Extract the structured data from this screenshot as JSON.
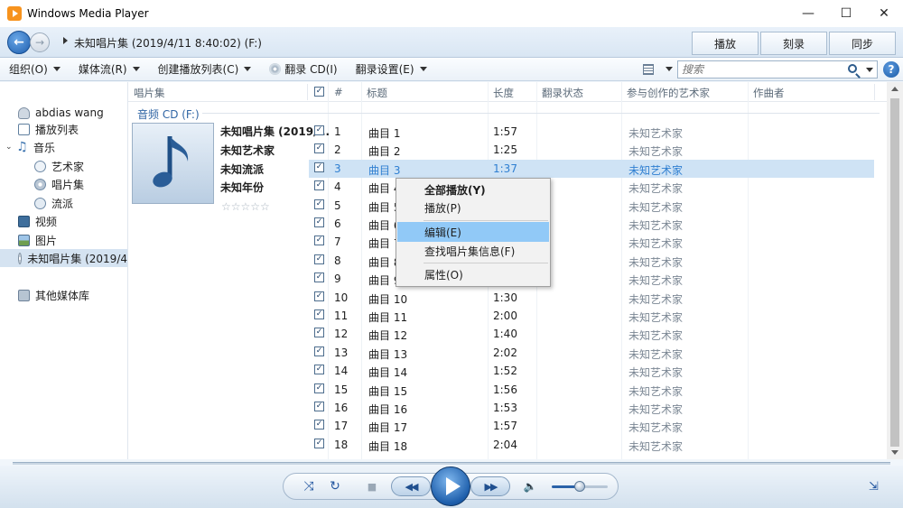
{
  "window": {
    "title": "Windows Media Player",
    "minimize": "—",
    "maximize": "☐",
    "close": "✕"
  },
  "nav": {
    "back": "←",
    "forward": "→",
    "breadcrumb": "未知唱片集 (2019/4/11 8:40:02) (F:)",
    "tabs": [
      "播放",
      "刻录",
      "同步"
    ]
  },
  "toolbar": {
    "organize": "组织(O)",
    "stream": "媒体流(R)",
    "create_playlist": "创建播放列表(C)",
    "rip_cd": "翻录 CD(I)",
    "rip_settings": "翻录设置(E)",
    "search_placeholder": "搜索",
    "help": "?"
  },
  "sidebar": {
    "items": [
      {
        "label": "abdias wang",
        "icon": "user-icon",
        "indent": 0
      },
      {
        "label": "播放列表",
        "icon": "playlist-icon",
        "indent": 0
      },
      {
        "label": "音乐",
        "icon": "music-icon",
        "indent": 0,
        "expander": "⌄"
      },
      {
        "label": "艺术家",
        "icon": "artist-icon",
        "indent": 1
      },
      {
        "label": "唱片集",
        "icon": "album-icon",
        "indent": 1
      },
      {
        "label": "流派",
        "icon": "genre-icon",
        "indent": 1
      },
      {
        "label": "视频",
        "icon": "video-icon",
        "indent": 0
      },
      {
        "label": "图片",
        "icon": "picture-icon",
        "indent": 0
      },
      {
        "label": "未知唱片集 (2019/4",
        "icon": "cd-icon",
        "indent": 0,
        "selected": true
      },
      {
        "label": "其他媒体库",
        "icon": "other-libraries-icon",
        "indent": 0
      }
    ]
  },
  "columns": {
    "album": "唱片集",
    "number": "#",
    "title": "标题",
    "length": "长度",
    "rip_status": "翻录状态",
    "contributing_artist": "参与创作的艺术家",
    "composer": "作曲者"
  },
  "group": {
    "label": "音频 CD (F:)",
    "album": "未知唱片集 (2019/...",
    "artist": "未知艺术家",
    "genre": "未知流派",
    "year": "未知年份",
    "rating": "☆☆☆☆☆"
  },
  "tracks": [
    {
      "num": "1",
      "title": "曲目 1",
      "length": "1:57",
      "artist": "未知艺术家"
    },
    {
      "num": "2",
      "title": "曲目 2",
      "length": "1:25",
      "artist": "未知艺术家"
    },
    {
      "num": "3",
      "title": "曲目 3",
      "length": "1:37",
      "artist": "未知艺术家",
      "highlight": true
    },
    {
      "num": "4",
      "title": "曲目 4",
      "length": "",
      "artist": "未知艺术家"
    },
    {
      "num": "5",
      "title": "曲目 5",
      "length": "",
      "artist": "未知艺术家"
    },
    {
      "num": "6",
      "title": "曲目 6",
      "length": "",
      "artist": "未知艺术家"
    },
    {
      "num": "7",
      "title": "曲目 7",
      "length": "",
      "artist": "未知艺术家"
    },
    {
      "num": "8",
      "title": "曲目 8",
      "length": "",
      "artist": "未知艺术家"
    },
    {
      "num": "9",
      "title": "曲目 9",
      "length": "",
      "artist": "未知艺术家"
    },
    {
      "num": "10",
      "title": "曲目 10",
      "length": "1:30",
      "artist": "未知艺术家"
    },
    {
      "num": "11",
      "title": "曲目 11",
      "length": "2:00",
      "artist": "未知艺术家"
    },
    {
      "num": "12",
      "title": "曲目 12",
      "length": "1:40",
      "artist": "未知艺术家"
    },
    {
      "num": "13",
      "title": "曲目 13",
      "length": "2:02",
      "artist": "未知艺术家"
    },
    {
      "num": "14",
      "title": "曲目 14",
      "length": "1:52",
      "artist": "未知艺术家"
    },
    {
      "num": "15",
      "title": "曲目 15",
      "length": "1:56",
      "artist": "未知艺术家"
    },
    {
      "num": "16",
      "title": "曲目 16",
      "length": "1:53",
      "artist": "未知艺术家"
    },
    {
      "num": "17",
      "title": "曲目 17",
      "length": "1:57",
      "artist": "未知艺术家"
    },
    {
      "num": "18",
      "title": "曲目 18",
      "length": "2:04",
      "artist": "未知艺术家"
    }
  ],
  "context_menu": {
    "play_all": "全部播放(Y)",
    "play": "播放(P)",
    "edit": "编辑(E)",
    "find_album_info": "查找唱片集信息(F)",
    "properties": "属性(O)"
  },
  "player": {
    "shuffle": "⤨",
    "repeat": "↻",
    "stop": "■",
    "previous": "◀◀",
    "next": "▶▶",
    "mute": "🔈",
    "switch_view": "⇲",
    "volume_percent": 50
  },
  "colors": {
    "accent": "#1d5eab",
    "highlight_row": "#cfe3f5",
    "menu_hover": "#91c9f7"
  }
}
